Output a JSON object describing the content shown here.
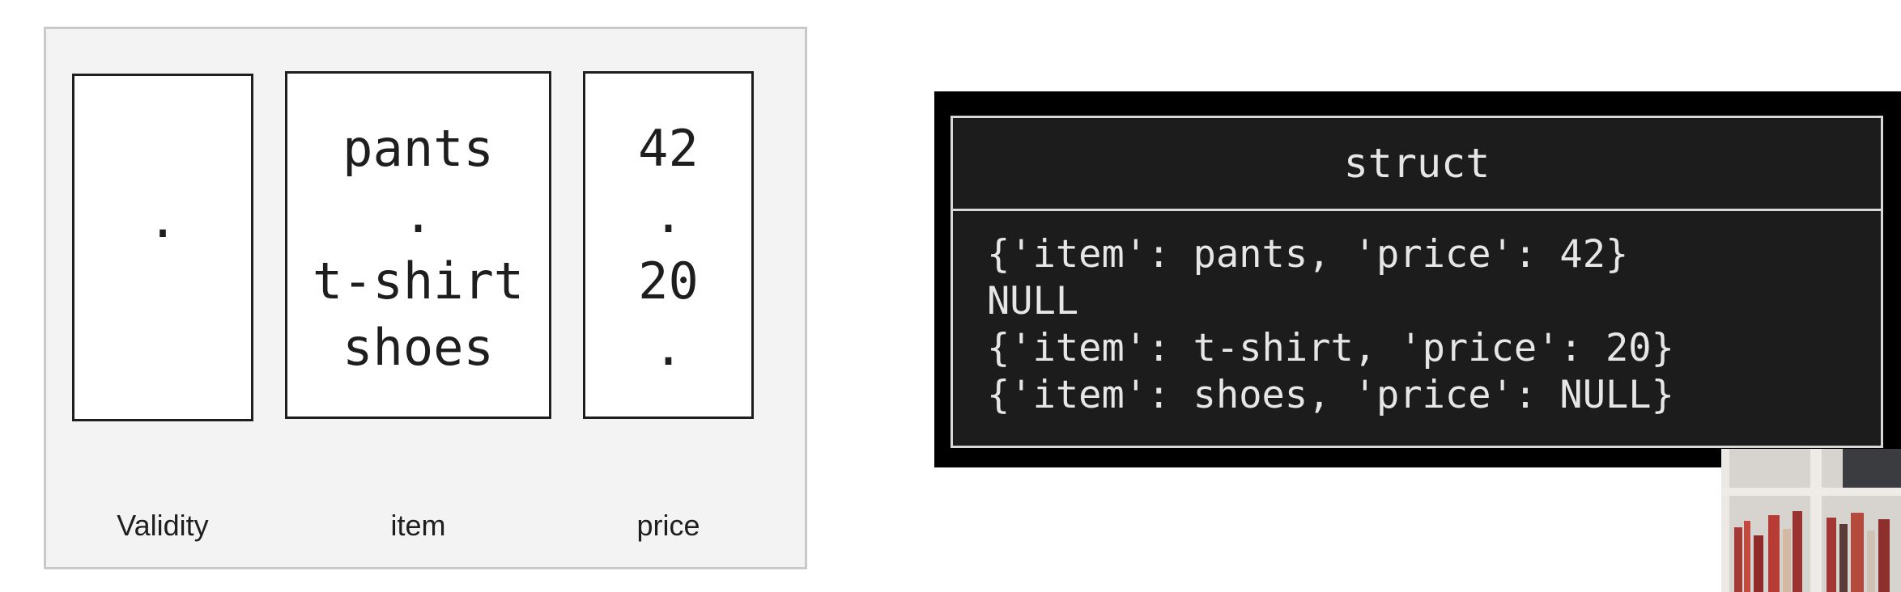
{
  "diagram": {
    "columns": [
      {
        "label": "Validity",
        "cells": [
          "",
          ".",
          "",
          ""
        ]
      },
      {
        "label": "item",
        "cells": [
          "pants",
          ".",
          "t-shirt",
          "shoes"
        ]
      },
      {
        "label": "price",
        "cells": [
          "42",
          ".",
          "20",
          "."
        ]
      }
    ]
  },
  "terminal": {
    "header": "struct",
    "rows": [
      "{'item': pants, 'price': 42}",
      "NULL",
      "{'item': t-shirt, 'price': 20}",
      "{'item': shoes, 'price': NULL}"
    ]
  },
  "colors": {
    "panel_bg": "#f3f3f3",
    "panel_border": "#c9c9c9",
    "terminal_bg": "#1c1c1c",
    "terminal_text": "#e6e6e6"
  }
}
